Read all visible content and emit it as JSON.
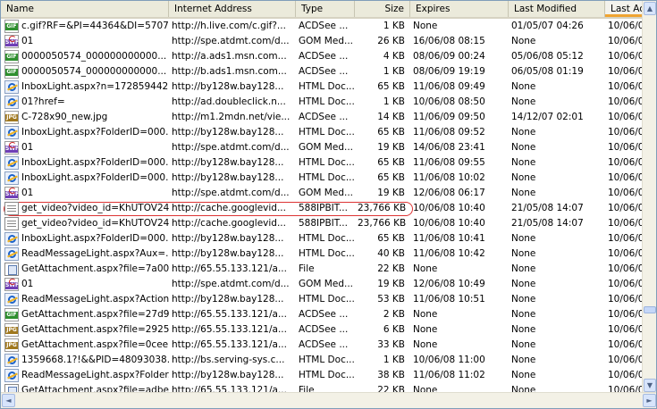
{
  "columns": [
    {
      "label": "Name",
      "align": "left"
    },
    {
      "label": "Internet Address",
      "align": "left"
    },
    {
      "label": "Type",
      "align": "left"
    },
    {
      "label": "Size",
      "align": "right"
    },
    {
      "label": "Expires",
      "align": "left"
    },
    {
      "label": "Last Modified",
      "align": "left"
    },
    {
      "label": "Last Ac",
      "align": "left",
      "sorted": true
    }
  ],
  "rows": [
    {
      "icon": "gif",
      "name": "c.gif?RF=&PI=44364&DI=5707...",
      "address": "http://h.live.com/c.gif?...",
      "type": "ACDSee ...",
      "size": "1 KB",
      "expires": "None",
      "modified": "01/05/07 04:26",
      "accessed": "10/06/0"
    },
    {
      "icon": "swf",
      "name": "01",
      "address": "http://spe.atdmt.com/d...",
      "type": "GOM Med...",
      "size": "26 KB",
      "expires": "16/06/08 08:15",
      "modified": "None",
      "accessed": "10/06/0"
    },
    {
      "icon": "gif",
      "name": "0000050574_000000000000...",
      "address": "http://a.ads1.msn.com...",
      "type": "ACDSee ...",
      "size": "4 KB",
      "expires": "08/06/09 00:24",
      "modified": "05/06/08 05:12",
      "accessed": "10/06/0"
    },
    {
      "icon": "gif",
      "name": "0000050574_000000000000...",
      "address": "http://b.ads1.msn.com...",
      "type": "ACDSee ...",
      "size": "1 KB",
      "expires": "08/06/09 19:19",
      "modified": "06/05/08 01:19",
      "accessed": "10/06/0"
    },
    {
      "icon": "ie",
      "name": "InboxLight.aspx?n=1728594421",
      "address": "http://by128w.bay128...",
      "type": "HTML Doc...",
      "size": "65 KB",
      "expires": "11/06/08 09:49",
      "modified": "None",
      "accessed": "10/06/0"
    },
    {
      "icon": "ie",
      "name": "01?href=",
      "address": "http://ad.doubleclick.n...",
      "type": "HTML Doc...",
      "size": "1 KB",
      "expires": "10/06/08 08:50",
      "modified": "None",
      "accessed": "10/06/0"
    },
    {
      "icon": "jpg",
      "name": "C-728x90_new.jpg",
      "address": "http://m1.2mdn.net/vie...",
      "type": "ACDSee ...",
      "size": "14 KB",
      "expires": "11/06/09 09:50",
      "modified": "14/12/07 02:01",
      "accessed": "10/06/0"
    },
    {
      "icon": "ie",
      "name": "InboxLight.aspx?FolderID=000...",
      "address": "http://by128w.bay128...",
      "type": "HTML Doc...",
      "size": "65 KB",
      "expires": "11/06/08 09:52",
      "modified": "None",
      "accessed": "10/06/0"
    },
    {
      "icon": "swf",
      "name": "01",
      "address": "http://spe.atdmt.com/d...",
      "type": "GOM Med...",
      "size": "19 KB",
      "expires": "14/06/08 23:41",
      "modified": "None",
      "accessed": "10/06/0"
    },
    {
      "icon": "ie",
      "name": "InboxLight.aspx?FolderID=000...",
      "address": "http://by128w.bay128...",
      "type": "HTML Doc...",
      "size": "65 KB",
      "expires": "11/06/08 09:55",
      "modified": "None",
      "accessed": "10/06/0"
    },
    {
      "icon": "ie",
      "name": "InboxLight.aspx?FolderID=000...",
      "address": "http://by128w.bay128...",
      "type": "HTML Doc...",
      "size": "65 KB",
      "expires": "11/06/08 10:02",
      "modified": "None",
      "accessed": "10/06/0"
    },
    {
      "icon": "swf",
      "name": "01",
      "address": "http://spe.atdmt.com/d...",
      "type": "GOM Med...",
      "size": "19 KB",
      "expires": "12/06/08 06:17",
      "modified": "None",
      "accessed": "10/06/0"
    },
    {
      "icon": "doc",
      "name": "get_video?video_id=KhUTOV24...",
      "address": "http://cache.googlevid...",
      "type": "588IPBIT...",
      "size": "23,766 KB",
      "expires": "10/06/08 10:40",
      "modified": "21/05/08 14:07",
      "accessed": "10/06/0"
    },
    {
      "icon": "doc",
      "name": "get_video?video_id=KhUTOV24...",
      "address": "http://cache.googlevid...",
      "type": "588IPBIT...",
      "size": "23,766 KB",
      "expires": "10/06/08 10:40",
      "modified": "21/05/08 14:07",
      "accessed": "10/06/0"
    },
    {
      "icon": "ie",
      "name": "InboxLight.aspx?FolderID=000...",
      "address": "http://by128w.bay128...",
      "type": "HTML Doc...",
      "size": "65 KB",
      "expires": "11/06/08 10:41",
      "modified": "None",
      "accessed": "10/06/0"
    },
    {
      "icon": "ie",
      "name": "ReadMessageLight.aspx?Aux=...",
      "address": "http://by128w.bay128...",
      "type": "HTML Doc...",
      "size": "40 KB",
      "expires": "11/06/08 10:42",
      "modified": "None",
      "accessed": "10/06/0"
    },
    {
      "icon": "file",
      "name": "GetAttachment.aspx?file=7a00...",
      "address": "http://65.55.133.121/a...",
      "type": "File",
      "size": "22 KB",
      "expires": "None",
      "modified": "None",
      "accessed": "10/06/0"
    },
    {
      "icon": "swf",
      "name": "01",
      "address": "http://spe.atdmt.com/d...",
      "type": "GOM Med...",
      "size": "19 KB",
      "expires": "12/06/08 10:49",
      "modified": "None",
      "accessed": "10/06/0"
    },
    {
      "icon": "ie",
      "name": "ReadMessageLight.aspx?Action...",
      "address": "http://by128w.bay128...",
      "type": "HTML Doc...",
      "size": "53 KB",
      "expires": "11/06/08 10:51",
      "modified": "None",
      "accessed": "10/06/0"
    },
    {
      "icon": "gif",
      "name": "GetAttachment.aspx?file=27d9...",
      "address": "http://65.55.133.121/a...",
      "type": "ACDSee ...",
      "size": "2 KB",
      "expires": "None",
      "modified": "None",
      "accessed": "10/06/0"
    },
    {
      "icon": "jpg",
      "name": "GetAttachment.aspx?file=2925...",
      "address": "http://65.55.133.121/a...",
      "type": "ACDSee ...",
      "size": "6 KB",
      "expires": "None",
      "modified": "None",
      "accessed": "10/06/0"
    },
    {
      "icon": "jpg",
      "name": "GetAttachment.aspx?file=0cee...",
      "address": "http://65.55.133.121/a...",
      "type": "ACDSee ...",
      "size": "33 KB",
      "expires": "None",
      "modified": "None",
      "accessed": "10/06/0"
    },
    {
      "icon": "ie",
      "name": "1359668.1?!&&PID=48093038...",
      "address": "http://bs.serving-sys.c...",
      "type": "HTML Doc...",
      "size": "1 KB",
      "expires": "10/06/08 11:00",
      "modified": "None",
      "accessed": "10/06/0"
    },
    {
      "icon": "ie",
      "name": "ReadMessageLight.aspx?Folder...",
      "address": "http://by128w.bay128...",
      "type": "HTML Doc...",
      "size": "38 KB",
      "expires": "11/06/08 11:02",
      "modified": "None",
      "accessed": "10/06/0"
    },
    {
      "icon": "file",
      "name": "GetAttachment.aspx?file=adbe...",
      "address": "http://65.55.133.121/a...",
      "type": "File",
      "size": "22 KB",
      "expires": "None",
      "modified": "None",
      "accessed": "10/06/0"
    }
  ],
  "highlighted_row": 12,
  "icon_labels": {
    "gif": "GIF",
    "jpg": "JPG",
    "swf": "SWF"
  },
  "scroll": {
    "up": "▲",
    "down": "▼",
    "left": "◄",
    "right": "►"
  },
  "vertical_scroll_position": 0.78
}
